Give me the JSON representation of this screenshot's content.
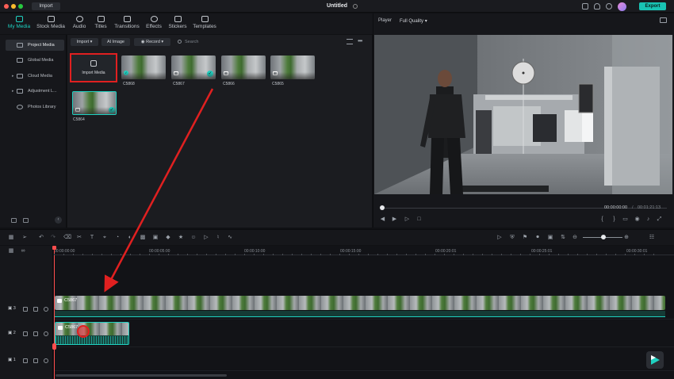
{
  "titlebar": {
    "import_label": "Import",
    "title": "Untitled",
    "export_label": "Export",
    "colors": {
      "accent": "#19c3b4",
      "close": "#ff5f57",
      "minimize": "#febc2e",
      "zoom": "#28c840"
    }
  },
  "main_tabs": [
    {
      "label": "My Media",
      "icon": "media-icon"
    },
    {
      "label": "Stock Media",
      "icon": "stock-media-icon"
    },
    {
      "label": "Audio",
      "icon": "music-note-icon"
    },
    {
      "label": "Titles",
      "icon": "text-icon"
    },
    {
      "label": "Transitions",
      "icon": "transition-icon"
    },
    {
      "label": "Effects",
      "icon": "sparkle-icon"
    },
    {
      "label": "Stickers",
      "icon": "sticker-icon"
    },
    {
      "label": "Templates",
      "icon": "template-icon"
    }
  ],
  "sidebar": {
    "items": [
      {
        "label": "Project Media",
        "active": true
      },
      {
        "label": "Global Media",
        "active": false
      },
      {
        "label": "Cloud Media",
        "active": false
      },
      {
        "label": "Adjustment L...",
        "active": false
      },
      {
        "label": "Photos Library",
        "active": false
      }
    ]
  },
  "media_toolbar": {
    "import_label": "Import",
    "ai_image_label": "AI Image",
    "record_label": "Record",
    "search_placeholder": "Search"
  },
  "media": {
    "import_tile_label": "Import Media",
    "clips": [
      {
        "label": "C5868"
      },
      {
        "label": "C5867"
      },
      {
        "label": "C5866"
      },
      {
        "label": "C5865"
      },
      {
        "label": "C5864"
      }
    ]
  },
  "player": {
    "label": "Player",
    "quality": "Full Quality",
    "current_time": "00:00:00:00",
    "separator": "/",
    "total_time": "00:01:21:13"
  },
  "timeline": {
    "ruler": [
      "00:00:00:00",
      "00:00:05:00",
      "00:00:10:00",
      "00:00:15:00",
      "00:00:20:01",
      "00:00:25:01",
      "00:00:30:01"
    ],
    "tracks": [
      {
        "number": "3"
      },
      {
        "number": "2"
      },
      {
        "number": "1"
      }
    ],
    "clip_top_label": "C5867",
    "clip_bottom_label": "C5867"
  }
}
